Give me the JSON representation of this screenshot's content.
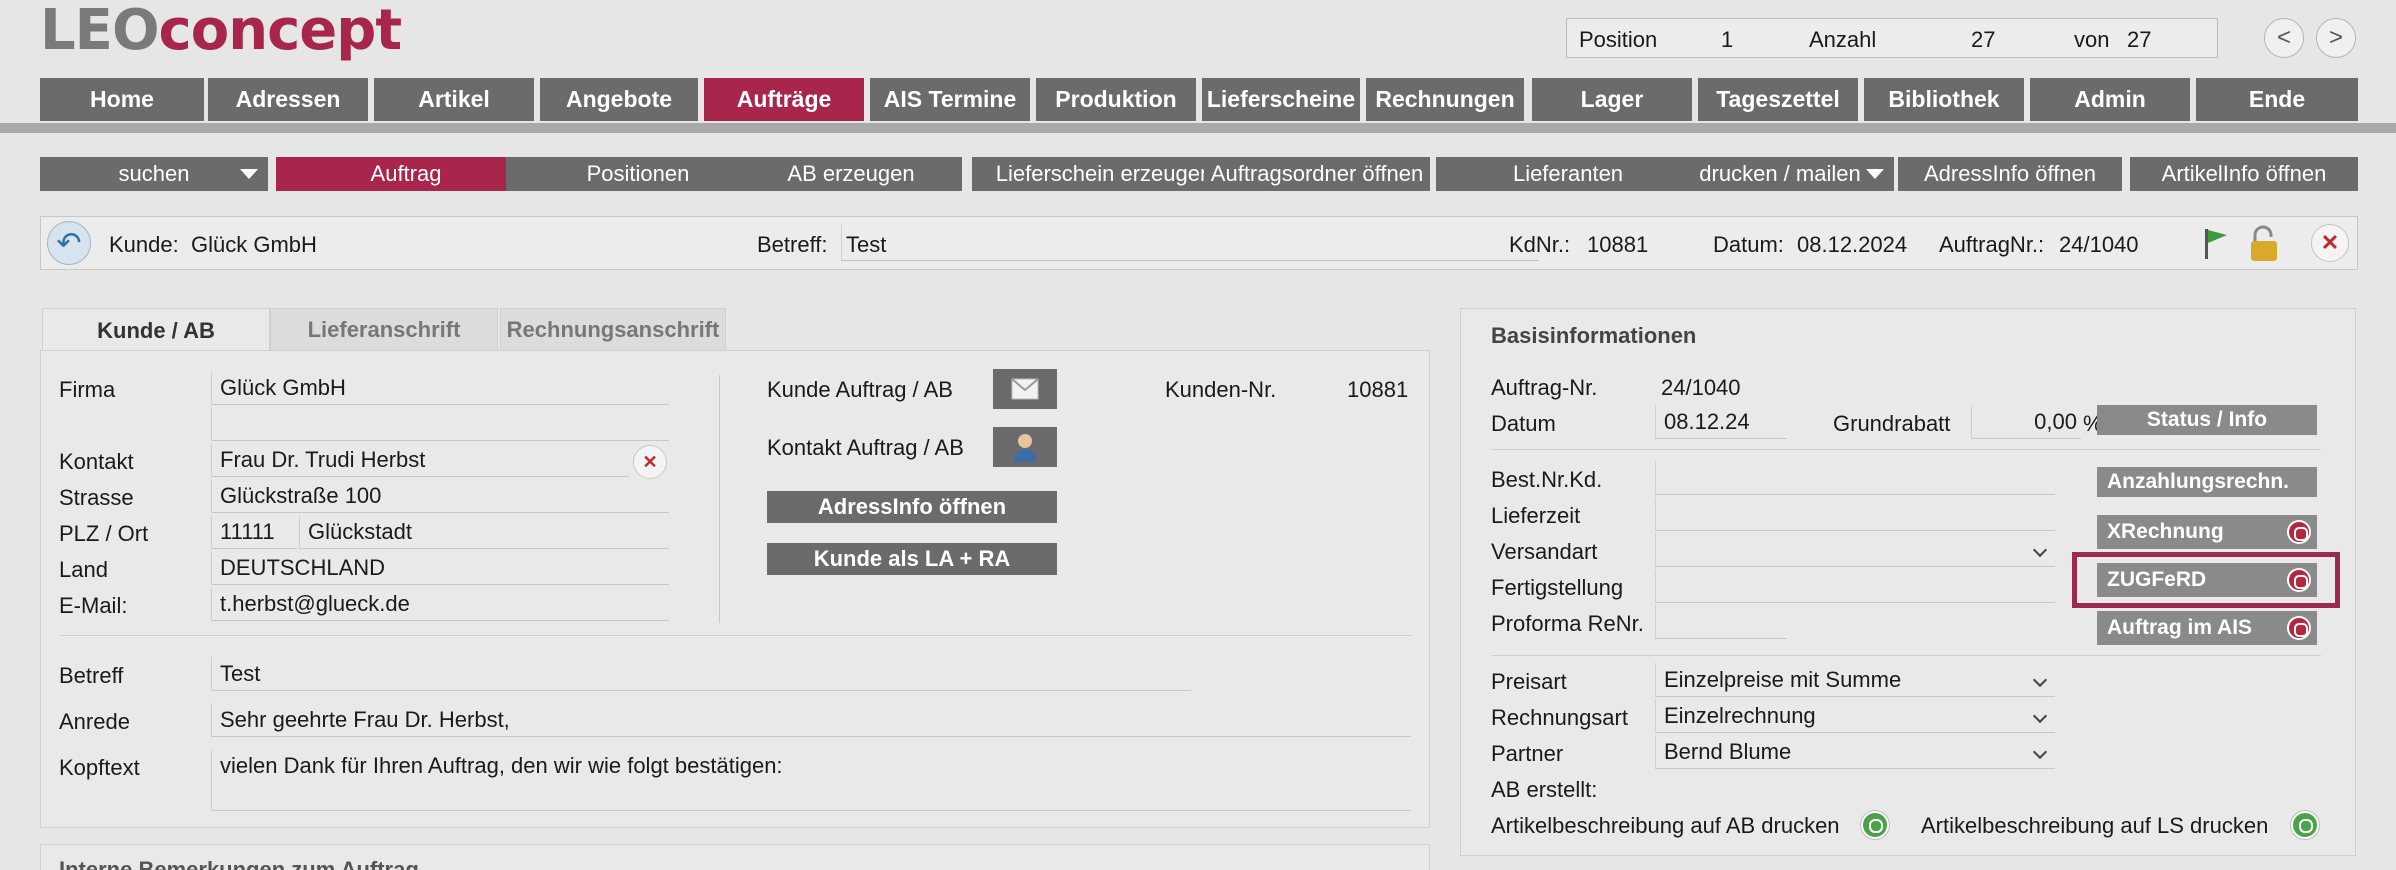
{
  "brand": {
    "part1": "LEO",
    "part2": "concept"
  },
  "position_bar": {
    "position_label": "Position",
    "position_value": "1",
    "count_label": "Anzahl",
    "count_value": "27",
    "of_label": "von",
    "of_value": "27",
    "prev": "<",
    "next": ">"
  },
  "main_nav": [
    "Home",
    "Adressen",
    "Artikel",
    "Angebote",
    "Aufträge",
    "AIS Termine",
    "Produktion",
    "Lieferscheine",
    "Rechnungen",
    "Lager",
    "Tageszettel",
    "Bibliothek",
    "Admin",
    "Ende"
  ],
  "toolbar": [
    "suchen",
    "Auftrag",
    "Positionen",
    "AB erzeugen",
    "Lieferschein erzeugen",
    "Auftragsordner öffnen",
    "Lieferanten",
    "drucken / mailen",
    "AdressInfo öffnen",
    "ArtikelInfo öffnen"
  ],
  "kundebar": {
    "kunde_label": "Kunde:",
    "kunde_value": "Glück GmbH",
    "betreff_label": "Betreff:",
    "betreff_value": "Test",
    "kdnr_label": "KdNr.:",
    "kdnr_value": "10881",
    "datum_label": "Datum:",
    "datum_value": "08.12.2024",
    "auftragnr_label": "AuftragNr.:",
    "auftragnr_value": "24/1040"
  },
  "tabs": [
    "Kunde / AB",
    "Lieferanschrift",
    "Rechnungsanschrift"
  ],
  "customer": {
    "firma_label": "Firma",
    "firma": "Glück GmbH",
    "kontakt_label": "Kontakt",
    "kontakt": "Frau Dr. Trudi Herbst",
    "strasse_label": "Strasse",
    "strasse": "Glückstraße 100",
    "plz_label": "PLZ / Ort",
    "plz": "11111",
    "ort": "Glückstadt",
    "land_label": "Land",
    "land": "DEUTSCHLAND",
    "email_label": "E-Mail:",
    "email": "t.herbst@glueck.de",
    "kunde_auftrag_label": "Kunde Auftrag / AB",
    "kontakt_auftrag_label": "Kontakt Auftrag / AB",
    "adressinfo_btn": "AdressInfo öffnen",
    "kunde_la_ra_btn": "Kunde als LA + RA",
    "kundennr_label": "Kunden-Nr.",
    "kundennr": "10881"
  },
  "letter": {
    "betreff_label": "Betreff",
    "betreff": "Test",
    "anrede_label": "Anrede",
    "anrede": "Sehr geehrte Frau Dr. Herbst,",
    "kopftext_label": "Kopftext",
    "kopftext": "vielen Dank für Ihren Auftrag, den wir wie folgt bestätigen:"
  },
  "bottom_panel_title": "Interne Bemerkungen zum Auftrag",
  "basis": {
    "title": "Basisinformationen",
    "auftragnr_label": "Auftrag-Nr.",
    "auftragnr": "24/1040",
    "datum_label": "Datum",
    "datum": "08.12.24",
    "grundrabatt_label": "Grundrabatt",
    "grundrabatt": "0,00",
    "percent": "%",
    "status_btn": "Status / Info",
    "bestnr_label": "Best.Nr.Kd.",
    "lieferzeit_label": "Lieferzeit",
    "versandart_label": "Versandart",
    "fertigstellung_label": "Fertigstellung",
    "proforma_label": "Proforma ReNr.",
    "anzahlung_btn": "Anzahlungsrechn.",
    "xrechnung_btn": "XRechnung",
    "zugferd_btn": "ZUGFeRD",
    "ais_btn": "Auftrag im AIS",
    "preisart_label": "Preisart",
    "preisart": "Einzelpreise mit Summe",
    "rechnungsart_label": "Rechnungsart",
    "rechnungsart": "Einzelrechnung",
    "partner_label": "Partner",
    "partner": "Bernd Blume",
    "ab_erstellt_label": "AB erstellt:",
    "artikel_ab_label": "Artikelbeschreibung auf AB drucken",
    "artikel_ls_label": "Artikelbeschreibung auf LS drucken"
  }
}
